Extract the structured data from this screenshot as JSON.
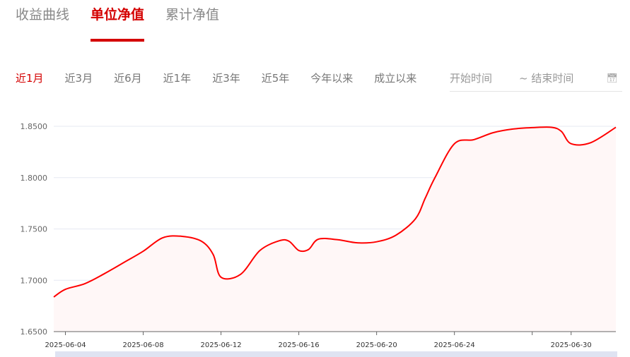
{
  "tabs": [
    {
      "label": "收益曲线"
    },
    {
      "label": "单位净值"
    },
    {
      "label": "累计净值"
    }
  ],
  "active_tab": 1,
  "ranges": [
    {
      "label": "近1月"
    },
    {
      "label": "近3月"
    },
    {
      "label": "近6月"
    },
    {
      "label": "近1年"
    },
    {
      "label": "近3年"
    },
    {
      "label": "近5年"
    },
    {
      "label": "今年以来"
    },
    {
      "label": "成立以来"
    }
  ],
  "date_range": {
    "start_placeholder": "开始时间",
    "end_placeholder": "~ 结束时间",
    "icon": "calendar-icon"
  },
  "colors": {
    "accent": "#d40000",
    "line": "#ff0000",
    "area": "#fff7f7",
    "grid": "#e6e8f2"
  },
  "chart_data": {
    "type": "area",
    "title": "单位净值",
    "xlabel": "",
    "ylabel": "",
    "ylim": [
      1.65,
      1.85
    ],
    "yticks": [
      "1.6500",
      "1.7000",
      "1.7500",
      "1.8000",
      "1.8500"
    ],
    "x_unit": "day of June 2025 (July 1 = 31)",
    "xlim": [
      3.4,
      32.3
    ],
    "xticks": [
      {
        "x": 4,
        "label": "2025-06-04"
      },
      {
        "x": 8,
        "label": "2025-06-08"
      },
      {
        "x": 12,
        "label": "2025-06-12"
      },
      {
        "x": 16,
        "label": "2025-06-16"
      },
      {
        "x": 20,
        "label": "2025-06-20"
      },
      {
        "x": 24,
        "label": "2025-06-24"
      },
      {
        "x": 28,
        "label": ""
      },
      {
        "x": 30,
        "label": "2025-06-30"
      }
    ],
    "grid": true,
    "series": [
      {
        "name": "单位净值",
        "points": [
          [
            3.4,
            1.6837
          ],
          [
            4,
            1.6912
          ],
          [
            5,
            1.6967
          ],
          [
            6,
            1.7064
          ],
          [
            7,
            1.7173
          ],
          [
            8,
            1.7283
          ],
          [
            9,
            1.7414
          ],
          [
            10,
            1.7428
          ],
          [
            11,
            1.738
          ],
          [
            11.6,
            1.725
          ],
          [
            12,
            1.703
          ],
          [
            13,
            1.7057
          ],
          [
            14,
            1.729
          ],
          [
            15,
            1.7385
          ],
          [
            15.5,
            1.738
          ],
          [
            16,
            1.729
          ],
          [
            16.5,
            1.73
          ],
          [
            17,
            1.74
          ],
          [
            18,
            1.7395
          ],
          [
            19,
            1.7365
          ],
          [
            20,
            1.7375
          ],
          [
            21,
            1.744
          ],
          [
            22,
            1.76
          ],
          [
            22.5,
            1.78
          ],
          [
            23,
            1.8
          ],
          [
            24,
            1.833
          ],
          [
            25,
            1.837
          ],
          [
            26,
            1.8438
          ],
          [
            27,
            1.8473
          ],
          [
            28,
            1.8487
          ],
          [
            29,
            1.849
          ],
          [
            29.5,
            1.845
          ],
          [
            30,
            1.833
          ],
          [
            31,
            1.834
          ],
          [
            32.3,
            1.849
          ]
        ]
      }
    ]
  }
}
